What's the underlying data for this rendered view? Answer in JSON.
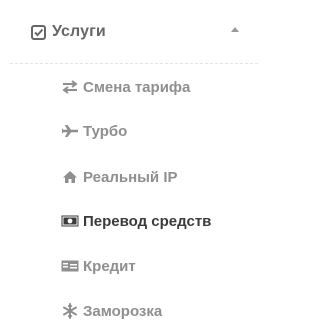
{
  "section": {
    "title": "Услуги",
    "check_icon": "checkbox-checked-icon",
    "toggle_icon": "chevron-up-icon"
  },
  "items": [
    {
      "label": "Смена тарифа",
      "icon": "exchange-icon",
      "active": false
    },
    {
      "label": "Турбо",
      "icon": "plane-icon",
      "active": false
    },
    {
      "label": "Реальный IP",
      "icon": "home-icon",
      "active": false
    },
    {
      "label": "Перевод средств",
      "icon": "money-icon",
      "active": true
    },
    {
      "label": "Кредит",
      "icon": "credit-card-icon",
      "active": false
    },
    {
      "label": "Заморозка",
      "icon": "snowflake-icon",
      "active": false
    }
  ],
  "colors": {
    "text_muted": "#8f8f8f",
    "text_active": "#3b3b3b",
    "header_text": "#666666"
  }
}
